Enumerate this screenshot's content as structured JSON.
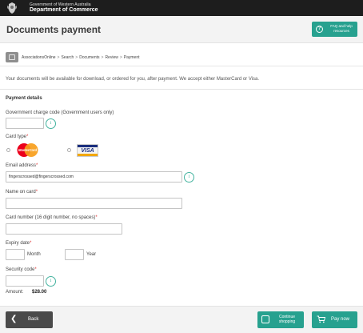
{
  "header": {
    "gov_line1": "Government of Western Australia",
    "gov_line2": "Department of Commerce",
    "title": "Documents payment",
    "faq_label": "FAQ and help resources"
  },
  "breadcrumb": [
    "AssociationsOnline",
    "Search",
    "Documents",
    "Review",
    "Payment"
  ],
  "breadcrumb_separator": ">",
  "intro": "Your documents will be available for download, or ordered for you, after payment. We accept either MasterCard or Visa.",
  "form": {
    "section_title": "Payment details",
    "charge_code_label": "Government charge code (Government users only)",
    "charge_code_value": "",
    "card_type_label": "Card type",
    "card_options": [
      "MasterCard",
      "VISA"
    ],
    "email_label": "Email address",
    "email_value": "fingerscrossed@fingerscrossed.com",
    "name_label": "Name on card",
    "name_value": "",
    "number_label": "Card number (16 digit number, no spaces)",
    "number_value": "",
    "expiry_label": "Expiry date",
    "month_label": "Month",
    "year_label": "Year",
    "security_label": "Security code",
    "required_mark": "*",
    "info_glyph": "i",
    "amount_label": "Amount:",
    "amount_value": "$28.00"
  },
  "footer": {
    "back_label": "Back",
    "continue_label": "Continue shopping",
    "pay_label": "Pay now"
  },
  "icons": {
    "crest": "coat-of-arms-icon",
    "faq": "question-icon",
    "breadcrumb": "home-icon",
    "info": "info-icon",
    "back": "chevron-left-icon",
    "continue": "shopping-bag-icon",
    "pay": "cart-icon"
  },
  "colors": {
    "accent": "#27a18f",
    "top_bar": "#1d1d1d",
    "required": "#dd3333",
    "dark_button": "#4a4a4a"
  }
}
